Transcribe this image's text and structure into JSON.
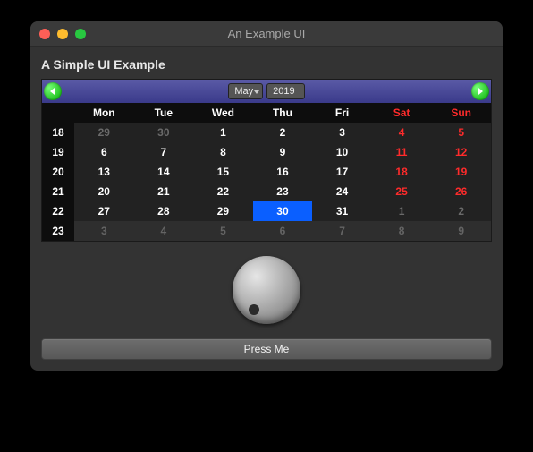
{
  "window": {
    "title": "An Example UI"
  },
  "heading": "A Simple UI Example",
  "calendar": {
    "month": "May",
    "year": "2019",
    "headers": [
      "Mon",
      "Tue",
      "Wed",
      "Thu",
      "Fri",
      "Sat",
      "Sun"
    ],
    "rows": [
      {
        "wk": "18",
        "days": [
          {
            "n": "29",
            "other": true
          },
          {
            "n": "30",
            "other": true
          },
          {
            "n": "1"
          },
          {
            "n": "2"
          },
          {
            "n": "3"
          },
          {
            "n": "4",
            "weekend": true
          },
          {
            "n": "5",
            "weekend": true
          }
        ]
      },
      {
        "wk": "19",
        "days": [
          {
            "n": "6"
          },
          {
            "n": "7"
          },
          {
            "n": "8"
          },
          {
            "n": "9"
          },
          {
            "n": "10"
          },
          {
            "n": "11",
            "weekend": true
          },
          {
            "n": "12",
            "weekend": true
          }
        ]
      },
      {
        "wk": "20",
        "days": [
          {
            "n": "13"
          },
          {
            "n": "14"
          },
          {
            "n": "15"
          },
          {
            "n": "16"
          },
          {
            "n": "17"
          },
          {
            "n": "18",
            "weekend": true
          },
          {
            "n": "19",
            "weekend": true
          }
        ]
      },
      {
        "wk": "21",
        "days": [
          {
            "n": "20"
          },
          {
            "n": "21"
          },
          {
            "n": "22"
          },
          {
            "n": "23"
          },
          {
            "n": "24"
          },
          {
            "n": "25",
            "weekend": true
          },
          {
            "n": "26",
            "weekend": true
          }
        ]
      },
      {
        "wk": "22",
        "days": [
          {
            "n": "27"
          },
          {
            "n": "28"
          },
          {
            "n": "29"
          },
          {
            "n": "30",
            "selected": true
          },
          {
            "n": "31"
          },
          {
            "n": "1",
            "weekend": true,
            "other": true
          },
          {
            "n": "2",
            "weekend": true,
            "other": true
          }
        ]
      },
      {
        "wk": "23",
        "days": [
          {
            "n": "3",
            "other": true
          },
          {
            "n": "4",
            "other": true
          },
          {
            "n": "5",
            "other": true
          },
          {
            "n": "6",
            "other": true
          },
          {
            "n": "7",
            "other": true
          },
          {
            "n": "8",
            "weekend": true,
            "other": true
          },
          {
            "n": "9",
            "weekend": true,
            "other": true
          }
        ]
      }
    ]
  },
  "button": {
    "label": "Press Me"
  }
}
